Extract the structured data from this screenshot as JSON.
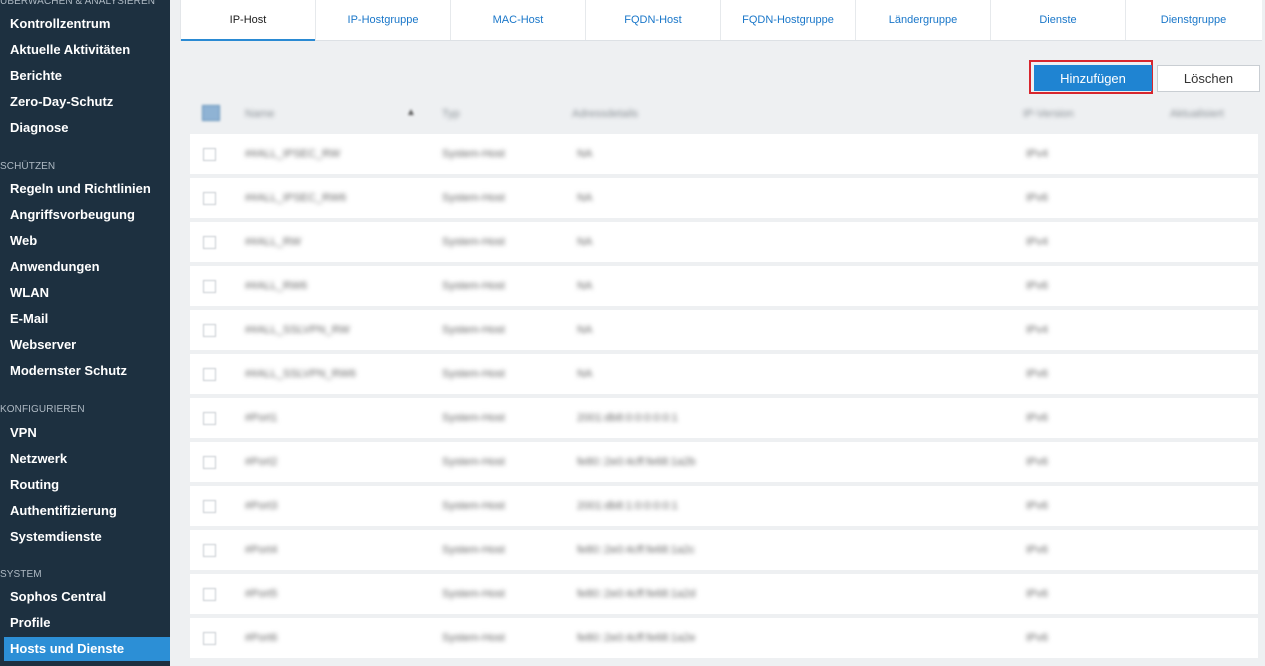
{
  "sidebar": {
    "sections": [
      {
        "head": "ÜBERWACHEN & ANALYSIEREN",
        "items": [
          "Kontrollzentrum",
          "Aktuelle Aktivitäten",
          "Berichte",
          "Zero-Day-Schutz",
          "Diagnose"
        ]
      },
      {
        "head": "SCHÜTZEN",
        "items": [
          "Regeln und Richtlinien",
          "Angriffsvorbeugung",
          "Web",
          "Anwendungen",
          "WLAN",
          "E-Mail",
          "Webserver",
          "Modernster Schutz"
        ]
      },
      {
        "head": "KONFIGURIEREN",
        "items": [
          "VPN",
          "Netzwerk",
          "Routing",
          "Authentifizierung",
          "Systemdienste"
        ]
      },
      {
        "head": "SYSTEM",
        "items": [
          "Sophos Central",
          "Profile",
          "Hosts und Dienste"
        ]
      }
    ],
    "active_item": "Hosts und Dienste"
  },
  "tabs": [
    "IP-Host",
    "IP-Hostgruppe",
    "MAC-Host",
    "FQDN-Host",
    "FQDN-Hostgruppe",
    "Ländergruppe",
    "Dienste",
    "Dienstgruppe"
  ],
  "active_tab": "IP-Host",
  "actions": {
    "add": "Hinzufügen",
    "delete": "Löschen"
  },
  "table": {
    "columns": [
      "Name",
      "Typ",
      "Adressdetails",
      "IP-Version",
      "Aktualisiert"
    ],
    "rows": [
      {
        "name": "##ALL_IPSEC_RW",
        "type": "System-Host",
        "address": "NA",
        "version": "IPv4"
      },
      {
        "name": "##ALL_IPSEC_RW6",
        "type": "System-Host",
        "address": "NA",
        "version": "IPv6"
      },
      {
        "name": "##ALL_RW",
        "type": "System-Host",
        "address": "NA",
        "version": "IPv4"
      },
      {
        "name": "##ALL_RW6",
        "type": "System-Host",
        "address": "NA",
        "version": "IPv6"
      },
      {
        "name": "##ALL_SSLVPN_RW",
        "type": "System-Host",
        "address": "NA",
        "version": "IPv4"
      },
      {
        "name": "##ALL_SSLVPN_RW6",
        "type": "System-Host",
        "address": "NA",
        "version": "IPv6"
      },
      {
        "name": "#Port1",
        "type": "System-Host",
        "address": "2001:db8:0:0:0:0:0:1",
        "version": "IPv6"
      },
      {
        "name": "#Port2",
        "type": "System-Host",
        "address": "fe80::2e0:4cff:fe68:1a2b",
        "version": "IPv6"
      },
      {
        "name": "#Port3",
        "type": "System-Host",
        "address": "2001:db8:1:0:0:0:0:1",
        "version": "IPv6"
      },
      {
        "name": "#Port4",
        "type": "System-Host",
        "address": "fe80::2e0:4cff:fe68:1a2c",
        "version": "IPv6"
      },
      {
        "name": "#Port5",
        "type": "System-Host",
        "address": "fe80::2e0:4cff:fe68:1a2d",
        "version": "IPv6"
      },
      {
        "name": "#Port6",
        "type": "System-Host",
        "address": "fe80::2e0:4cff:fe68:1a2e",
        "version": "IPv6"
      }
    ]
  }
}
